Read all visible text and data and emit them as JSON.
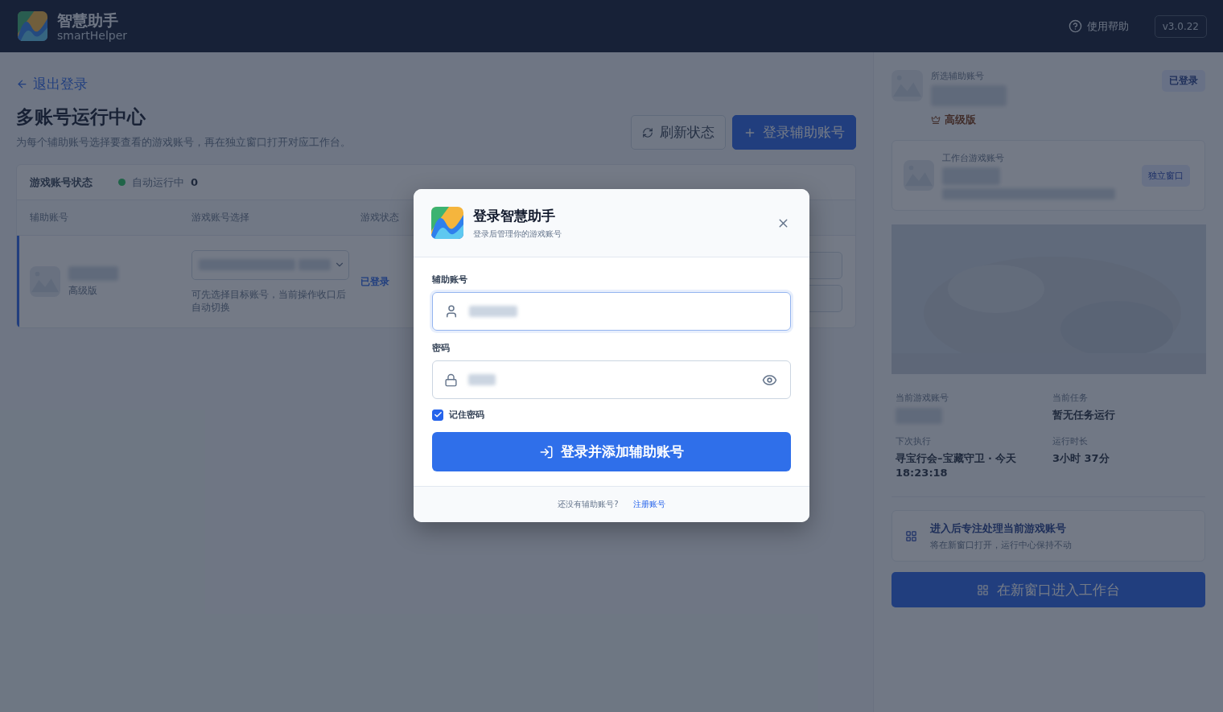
{
  "header": {
    "app_name": "智慧助手",
    "app_subtitle": "smartHelper",
    "help_label": "使用帮助",
    "version": "v3.0.22"
  },
  "main": {
    "back_link": "退出登录",
    "title": "多账号运行中心",
    "subtitle": "为每个辅助账号选择要查看的游戏账号，再在独立窗口打开对应工作台。",
    "refresh_button": "刷新状态",
    "add_button": "登录辅助账号",
    "table": {
      "title": "游戏账号状态",
      "status_label": "自动运行中",
      "status_count": "0",
      "columns": [
        "辅助账号",
        "游戏账号选择",
        "游戏状态"
      ],
      "rows": [
        {
          "edition": "高级版",
          "hint": "可先选择目标账号，当前操作收口后自动切换",
          "status": "已登录",
          "selected": true
        }
      ]
    }
  },
  "side": {
    "selected_label": "所选辅助账号",
    "status_badge": "已登录",
    "edition": "高级版",
    "workbench_label": "工作台游戏账号",
    "window_button": "独立窗口",
    "stats": [
      {
        "label": "当前游戏账号"
      },
      {
        "label": "当前任务",
        "value": "暂无任务运行"
      },
      {
        "label": "下次执行",
        "value": "寻宝行会–宝藏守卫 · 今天 18:23:18"
      },
      {
        "label": "运行时长",
        "value": "3小时 37分"
      }
    ],
    "focus_card": {
      "title": "进入后专注处理当前游戏账号",
      "subtitle": "将在新窗口打开，运行中心保持不动"
    },
    "enter_button": "在新窗口进入工作台"
  },
  "dialog": {
    "title": "登录智慧助手",
    "subtitle": "登录后管理你的游戏账号",
    "fields": [
      {
        "label": "辅助账号",
        "kind": "text",
        "focused": true
      },
      {
        "label": "密码",
        "kind": "password",
        "focused": false
      }
    ],
    "remember": {
      "label": "记住密码",
      "checked": true
    },
    "submit": "登录并添加辅助账号",
    "footer_text": "还没有辅助账号?",
    "register_link": "注册账号"
  }
}
